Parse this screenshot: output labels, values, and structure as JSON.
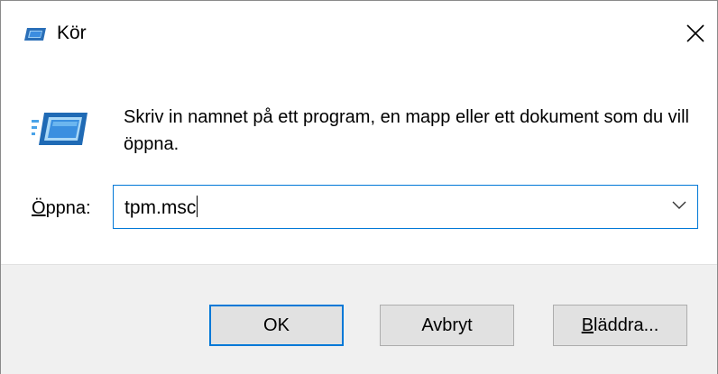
{
  "window": {
    "title": "Kör",
    "close_icon": "close-icon"
  },
  "content": {
    "description": "Skriv in namnet på ett program, en mapp eller ett dokument som du vill öppna.",
    "open_label_first": "Ö",
    "open_label_rest": "ppna:",
    "open_value": "tpm.msc"
  },
  "buttons": {
    "ok": "OK",
    "cancel": "Avbryt",
    "browse_first": "B",
    "browse_rest": "läddra..."
  },
  "colors": {
    "accent": "#0078d7",
    "footer_bg": "#f0f0f0",
    "button_bg": "#e1e1e1"
  }
}
